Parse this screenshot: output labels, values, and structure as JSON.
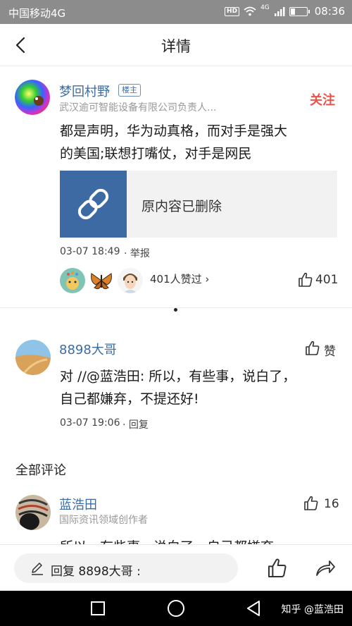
{
  "status_bar": {
    "carrier": "中国移动4G",
    "hd": "HD",
    "network": "4G",
    "time": "08:36",
    "battery_level": 0.3
  },
  "header": {
    "title": "详情",
    "back_icon": "chevron-left-icon"
  },
  "post": {
    "author": "梦回村野",
    "badge": "楼主",
    "subtitle": "武汉逾可智能设备有限公司负责人...",
    "follow": "关注",
    "text_line1": "都是声明，华为动真格，而对手是强大",
    "text_line2": "的美国;联想打嘴仗，对手是网民",
    "link_card": {
      "icon": "link-icon",
      "text": "原内容已删除"
    },
    "time": "03-07 18:49",
    "report": "· 举报",
    "likes_text": "401人赞过 ›",
    "like_count": "401"
  },
  "reply": {
    "author": "8898大哥",
    "like_label": "赞",
    "text_line1": "对 //@蓝浩田: 所以，有些事，说白了，",
    "text_line2": "自己都嫌弃，不提还好!",
    "time": "03-07 19:06",
    "reply_label": "· 回复"
  },
  "comments_section": {
    "title": "全部评论",
    "first": {
      "author": "蓝浩田",
      "subtitle": "国际资讯领域创作者",
      "like_count": "16",
      "text_preview": "所以，有些事，说白了，自己都嫌弃"
    }
  },
  "bottom_bar": {
    "reply_placeholder": "回复 8898大哥 :",
    "icons": [
      "pencil-icon",
      "thumbs-up-icon",
      "share-icon"
    ]
  },
  "nav_bar": {
    "watermark": "知乎 @蓝浩田"
  },
  "colors": {
    "link_blue": "#3a6ca4",
    "follow_red": "#e8534b",
    "status_bar_gray": "#8c8c8c",
    "card_blue": "#3e6aa3"
  }
}
